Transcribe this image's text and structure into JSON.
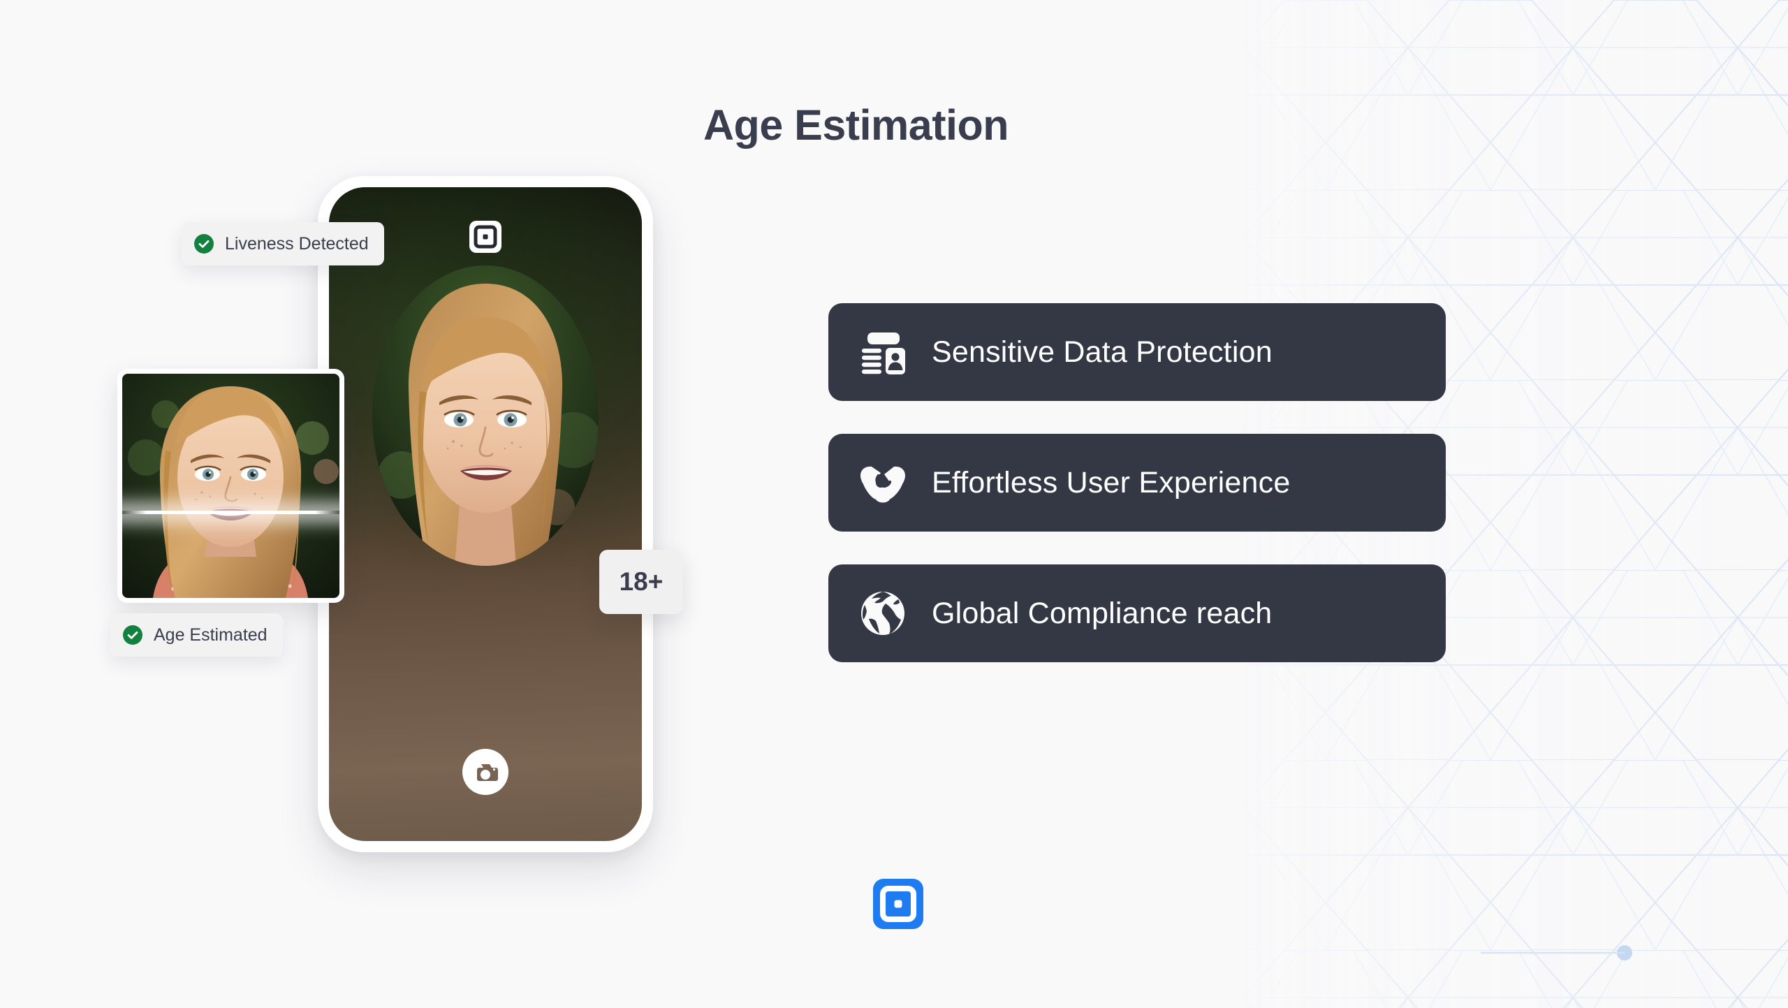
{
  "page": {
    "title": "Age Estimation",
    "background_color": "#F9F9FA",
    "title_color": "#3A3D4D",
    "accent_color": "#1E7BF0",
    "card_color": "#343845",
    "success_color": "#15803D"
  },
  "phone": {
    "top_logo_icon": "brand-square-logo-icon",
    "camera_icon": "camera-icon",
    "face_overlay": "face-oval-crop"
  },
  "badges": [
    {
      "id": "liveness",
      "icon": "check-circle-icon",
      "label": "Liveness Detected"
    },
    {
      "id": "age",
      "icon": "check-circle-icon",
      "label": "Age Estimated"
    }
  ],
  "age_rating": {
    "value": "18+"
  },
  "thumbnail": {
    "scan_line": "scanning-line"
  },
  "features": [
    {
      "icon": "id-card-icon",
      "label": "Sensitive Data Protection"
    },
    {
      "icon": "handshake-icon",
      "label": "Effortless User Experience"
    },
    {
      "icon": "globe-icon",
      "label": "Global Compliance reach"
    }
  ],
  "brand": {
    "logo_icon": "brand-square-logo-icon",
    "logo_color": "#1E7BF0"
  }
}
